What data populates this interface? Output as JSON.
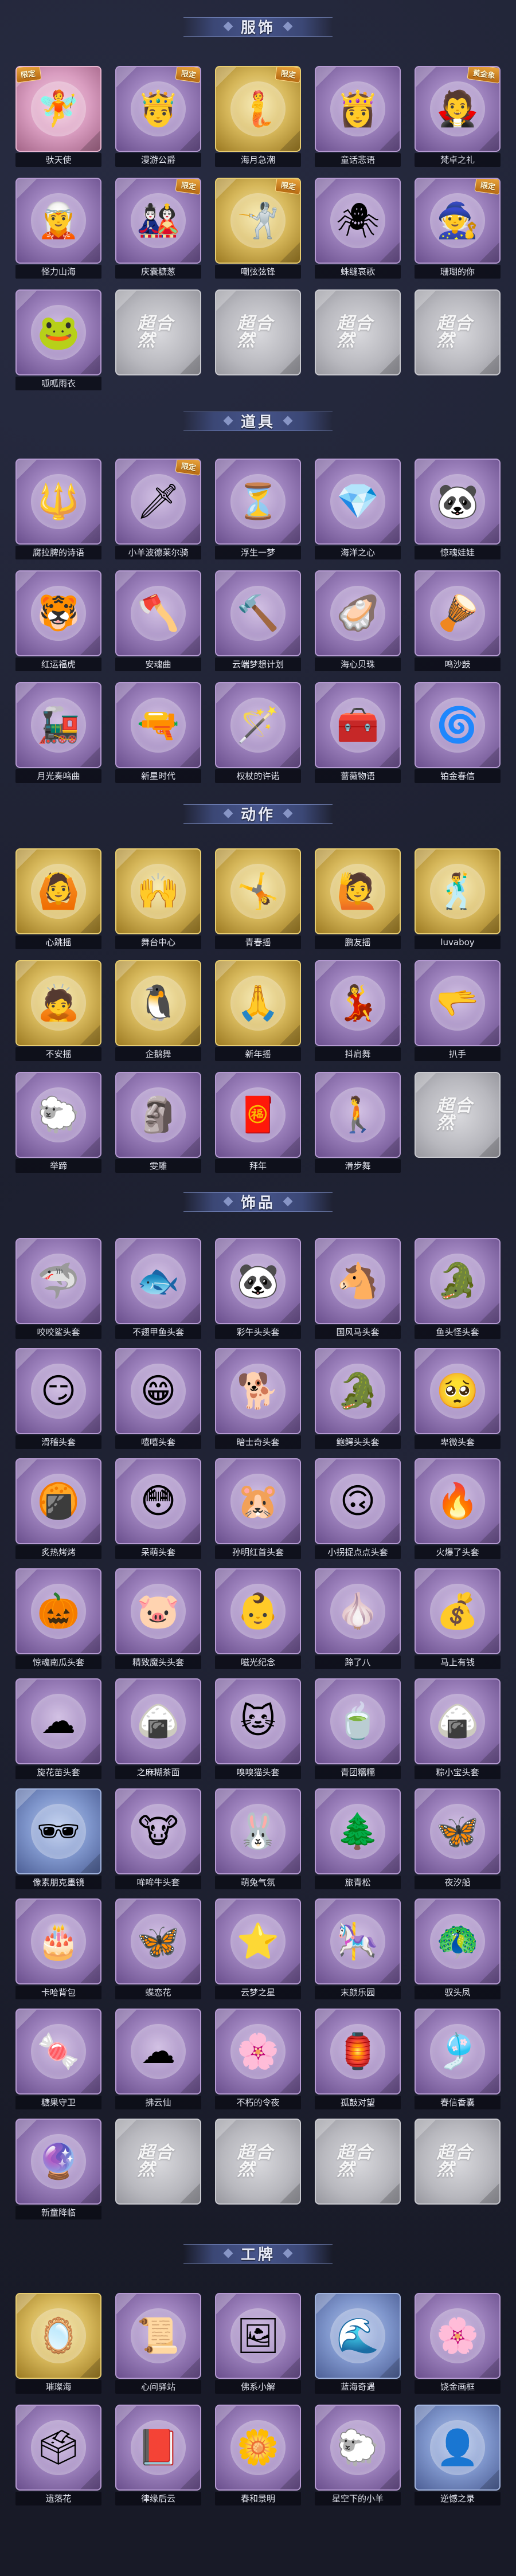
{
  "empty_watermark": "超合然",
  "sections": {
    "costumes": {
      "title": "服饰",
      "items": [
        {
          "label": "驮天使",
          "icon": "🧚",
          "style": "pink",
          "badge_left": "限定"
        },
        {
          "label": "漫游公爵",
          "icon": "🤴",
          "style": "purple",
          "badge": "限定"
        },
        {
          "label": "海月急潮",
          "icon": "🧜",
          "style": "gold",
          "badge": "限定"
        },
        {
          "label": "童话悲语",
          "icon": "👸",
          "style": "purple"
        },
        {
          "label": "梵卓之礼",
          "icon": "🧛",
          "style": "purple",
          "badge": "黄金象"
        },
        {
          "label": "怪力山海",
          "icon": "🧝",
          "style": "purple"
        },
        {
          "label": "庆囊糖葱",
          "icon": "🎎",
          "style": "purple",
          "badge": "限定"
        },
        {
          "label": "嘲弦弦锋",
          "icon": "🤺",
          "style": "gold",
          "badge": "限定"
        },
        {
          "label": "蛛缝哀歌",
          "icon": "🕷",
          "style": "purple"
        },
        {
          "label": "珊瑚的你",
          "icon": "🧙",
          "style": "purple",
          "badge": "限定"
        },
        {
          "label": "呱呱雨衣",
          "icon": "🐸",
          "style": "purple"
        },
        {
          "label": "",
          "icon": "",
          "style": "empty"
        },
        {
          "label": "",
          "icon": "",
          "style": "empty"
        },
        {
          "label": "",
          "icon": "",
          "style": "empty"
        },
        {
          "label": "",
          "icon": "",
          "style": "empty"
        }
      ]
    },
    "props": {
      "title": "道具",
      "items": [
        {
          "label": "腐拉脾的诗语",
          "icon": "🔱",
          "style": "purple"
        },
        {
          "label": "小羊波德莱尔骑",
          "icon": "🗡",
          "style": "purple",
          "badge": "限定"
        },
        {
          "label": "浮生一梦",
          "icon": "⏳",
          "style": "purple"
        },
        {
          "label": "海洋之心",
          "icon": "💎",
          "style": "purple"
        },
        {
          "label": "惊魂娃娃",
          "icon": "🐼",
          "style": "purple"
        },
        {
          "label": "红运福虎",
          "icon": "🐯",
          "style": "purple"
        },
        {
          "label": "安魂曲",
          "icon": "🪓",
          "style": "purple"
        },
        {
          "label": "云端梦想计划",
          "icon": "🔨",
          "style": "purple"
        },
        {
          "label": "海心贝珠",
          "icon": "🦪",
          "style": "purple"
        },
        {
          "label": "鸣沙鼓",
          "icon": "🪘",
          "style": "purple"
        },
        {
          "label": "月光奏鸣曲",
          "icon": "🚂",
          "style": "purple"
        },
        {
          "label": "新星时代",
          "icon": "🔫",
          "style": "purple"
        },
        {
          "label": "权杖的许诺",
          "icon": "🪄",
          "style": "purple"
        },
        {
          "label": "蔷薇物语",
          "icon": "🧰",
          "style": "purple"
        },
        {
          "label": "铂金春信",
          "icon": "🌀",
          "style": "purple"
        }
      ]
    },
    "actions": {
      "title": "动作",
      "items": [
        {
          "label": "心跳摇",
          "icon": "🙆",
          "style": "gold"
        },
        {
          "label": "舞台中心",
          "icon": "🙌",
          "style": "gold"
        },
        {
          "label": "青春摇",
          "icon": "🤸",
          "style": "gold"
        },
        {
          "label": "鹏友摇",
          "icon": "🙋",
          "style": "gold"
        },
        {
          "label": "luvaboy",
          "icon": "🕺",
          "style": "gold"
        },
        {
          "label": "不安摇",
          "icon": "🙇",
          "style": "gold"
        },
        {
          "label": "企鹅舞",
          "icon": "🐧",
          "style": "gold"
        },
        {
          "label": "新年摇",
          "icon": "🙏",
          "style": "gold"
        },
        {
          "label": "抖肩舞",
          "icon": "💃",
          "style": "purple"
        },
        {
          "label": "扒手",
          "icon": "🫳",
          "style": "purple"
        },
        {
          "label": "举蹄",
          "icon": "🐑",
          "style": "purple"
        },
        {
          "label": "雯雕",
          "icon": "🗿",
          "style": "purple"
        },
        {
          "label": "拜年",
          "icon": "🧧",
          "style": "purple"
        },
        {
          "label": "滑步舞",
          "icon": "🚶",
          "style": "purple"
        },
        {
          "label": "",
          "icon": "",
          "style": "empty"
        }
      ]
    },
    "accessories": {
      "title": "饰品",
      "items": [
        {
          "label": "咬咬鲨头套",
          "icon": "🦈",
          "style": "purple"
        },
        {
          "label": "不翅甲鱼头套",
          "icon": "🐟",
          "style": "purple"
        },
        {
          "label": "彩午头头套",
          "icon": "🐼",
          "style": "purple"
        },
        {
          "label": "国风马头套",
          "icon": "🐴",
          "style": "purple"
        },
        {
          "label": "鱼头怪头套",
          "icon": "🐊",
          "style": "purple"
        },
        {
          "label": "滑稽头套",
          "icon": "😏",
          "style": "purple"
        },
        {
          "label": "嘻嘻头套",
          "icon": "😁",
          "style": "purple"
        },
        {
          "label": "暗士奇头套",
          "icon": "🐕",
          "style": "purple"
        },
        {
          "label": "鲍鳄头头套",
          "icon": "🐊",
          "style": "purple"
        },
        {
          "label": "卑微头套",
          "icon": "🥺",
          "style": "purple"
        },
        {
          "label": "炙热烤烤",
          "icon": "🍘",
          "style": "purple"
        },
        {
          "label": "呆萌头套",
          "icon": "😳",
          "style": "purple"
        },
        {
          "label": "孙明红首头套",
          "icon": "🐹",
          "style": "purple"
        },
        {
          "label": "小拐捉点点头套",
          "icon": "🙃",
          "style": "purple"
        },
        {
          "label": "火爆了头套",
          "icon": "🔥",
          "style": "purple"
        },
        {
          "label": "惊魂南瓜头套",
          "icon": "🎃",
          "style": "purple"
        },
        {
          "label": "精致魔头头套",
          "icon": "🐷",
          "style": "purple"
        },
        {
          "label": "嗞光纪念",
          "icon": "👶",
          "style": "purple"
        },
        {
          "label": "蹄了八",
          "icon": "🧄",
          "style": "purple"
        },
        {
          "label": "马上有钱",
          "icon": "💰",
          "style": "purple"
        },
        {
          "label": "旋花苗头套",
          "icon": "☁",
          "style": "purple"
        },
        {
          "label": "之麻糊茶面",
          "icon": "🍙",
          "style": "purple"
        },
        {
          "label": "嗅嗅猫头套",
          "icon": "🐱",
          "style": "purple"
        },
        {
          "label": "青团糯糯",
          "icon": "🍵",
          "style": "purple"
        },
        {
          "label": "粽小宝头套",
          "icon": "🍙",
          "style": "purple"
        },
        {
          "label": "像素朋克墨镜",
          "icon": "🕶",
          "style": "blue"
        },
        {
          "label": "哞哞牛头套",
          "icon": "🐮",
          "style": "purple"
        },
        {
          "label": "萌兔气氛",
          "icon": "🐰",
          "style": "purple"
        },
        {
          "label": "旅青松",
          "icon": "🌲",
          "style": "purple"
        },
        {
          "label": "夜汐船",
          "icon": "🦋",
          "style": "purple"
        },
        {
          "label": "卡哈背包",
          "icon": "🎂",
          "style": "purple"
        },
        {
          "label": "蝶恋花",
          "icon": "🦋",
          "style": "purple"
        },
        {
          "label": "云梦之星",
          "icon": "⭐",
          "style": "purple"
        },
        {
          "label": "末颜乐园",
          "icon": "🎠",
          "style": "purple"
        },
        {
          "label": "驭头凤",
          "icon": "🦚",
          "style": "purple"
        },
        {
          "label": "糖果守卫",
          "icon": "🍬",
          "style": "purple"
        },
        {
          "label": "拂云仙",
          "icon": "☁",
          "style": "purple"
        },
        {
          "label": "不朽的令夜",
          "icon": "🌸",
          "style": "purple"
        },
        {
          "label": "孤鼓对望",
          "icon": "🏮",
          "style": "purple"
        },
        {
          "label": "春信香囊",
          "icon": "🎐",
          "style": "purple"
        },
        {
          "label": "新童降临",
          "icon": "🔮",
          "style": "purple"
        },
        {
          "label": "",
          "icon": "",
          "style": "empty"
        },
        {
          "label": "",
          "icon": "",
          "style": "empty"
        },
        {
          "label": "",
          "icon": "",
          "style": "empty"
        },
        {
          "label": "",
          "icon": "",
          "style": "empty"
        }
      ]
    },
    "badges": {
      "title": "工牌",
      "items": [
        {
          "label": "璀璨海",
          "icon": "🪞",
          "style": "gold"
        },
        {
          "label": "心间驿站",
          "icon": "📜",
          "style": "purple"
        },
        {
          "label": "佛系小解",
          "icon": "🖼",
          "style": "purple"
        },
        {
          "label": "蓝海奇遇",
          "icon": "🌊",
          "style": "blue"
        },
        {
          "label": "饶金画框",
          "icon": "🌸",
          "style": "purple"
        },
        {
          "label": "遗落花",
          "icon": "🗳",
          "style": "purple"
        },
        {
          "label": "律缘后云",
          "icon": "📕",
          "style": "purple"
        },
        {
          "label": "春和景明",
          "icon": "🌼",
          "style": "purple"
        },
        {
          "label": "星空下的小羊",
          "icon": "🐑",
          "style": "purple"
        },
        {
          "label": "逆憾之录",
          "icon": "👤",
          "style": "blue"
        }
      ]
    }
  }
}
